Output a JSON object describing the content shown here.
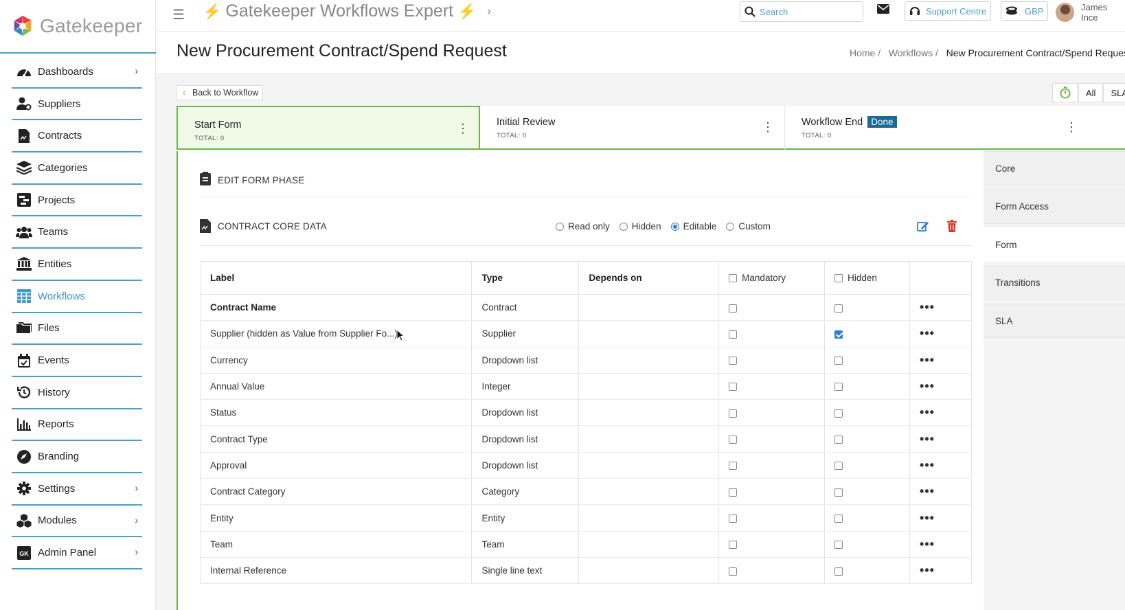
{
  "brand": {
    "name": "Gatekeeper",
    "colors": {
      "accent": "#4a9fc4",
      "green": "#6bb64a",
      "blue": "#2a7de1",
      "red": "#d9362b"
    }
  },
  "sidebar": {
    "items": [
      {
        "label": "Dashboards",
        "icon": "gauge-icon",
        "chevron": true
      },
      {
        "label": "Suppliers",
        "icon": "user-gear-icon",
        "chevron": false
      },
      {
        "label": "Contracts",
        "icon": "file-contract-icon",
        "chevron": false
      },
      {
        "label": "Categories",
        "icon": "layers-icon",
        "chevron": false
      },
      {
        "label": "Projects",
        "icon": "project-icon",
        "chevron": false
      },
      {
        "label": "Teams",
        "icon": "users-icon",
        "chevron": false
      },
      {
        "label": "Entities",
        "icon": "bank-icon",
        "chevron": false
      },
      {
        "label": "Workflows",
        "icon": "grid-table-icon",
        "chevron": false,
        "active": true
      },
      {
        "label": "Files",
        "icon": "folders-icon",
        "chevron": false
      },
      {
        "label": "Events",
        "icon": "calendar-icon",
        "chevron": false
      },
      {
        "label": "History",
        "icon": "history-icon",
        "chevron": false
      },
      {
        "label": "Reports",
        "icon": "bar-chart-icon",
        "chevron": false
      },
      {
        "label": "Branding",
        "icon": "compass-icon",
        "chevron": false
      },
      {
        "label": "Settings",
        "icon": "gear-icon",
        "chevron": true
      },
      {
        "label": "Modules",
        "icon": "cubes-icon",
        "chevron": true
      },
      {
        "label": "Admin Panel",
        "icon": "gk-badge-icon",
        "chevron": true
      }
    ]
  },
  "topbar": {
    "workflow_title": "Gatekeeper Workflows Expert",
    "search_placeholder": "Search",
    "support_label": "Support Centre",
    "currency_label": "GBP",
    "user_name": "James Ince"
  },
  "page": {
    "title": "New Procurement Contract/Spend Request",
    "breadcrumb": {
      "home": "Home",
      "sep": "/",
      "workflows": "Workflows",
      "current": "New Procurement Contract/Spend Request"
    },
    "back_label": "Back to Workflow",
    "filter_all": "All",
    "filter_sla": "SLA"
  },
  "phases": [
    {
      "name": "Start Form",
      "total": "TOTAL: 0",
      "active": true
    },
    {
      "name": "Initial Review",
      "total": "TOTAL: 0"
    },
    {
      "name": "Workflow End",
      "badge": "Done",
      "total": "TOTAL: 0"
    }
  ],
  "editor": {
    "edit_phase_label": "EDIT FORM PHASE",
    "section_label": "CONTRACT CORE DATA",
    "radios": [
      {
        "label": "Read only",
        "checked": false
      },
      {
        "label": "Hidden",
        "checked": false
      },
      {
        "label": "Editable",
        "checked": true
      },
      {
        "label": "Custom",
        "checked": false
      }
    ],
    "table": {
      "headers": {
        "label": "Label",
        "type": "Type",
        "depends": "Depends on",
        "mandatory": "Mandatory",
        "hidden": "Hidden"
      },
      "rows": [
        {
          "label": "Contract Name",
          "type": "Contract",
          "mandatory": false,
          "hidden": false,
          "bold": true
        },
        {
          "label": "Supplier (hidden as Value from Supplier Fo...)",
          "type": "Supplier",
          "mandatory": false,
          "hidden": true
        },
        {
          "label": "Currency",
          "type": "Dropdown list",
          "mandatory": false,
          "hidden": false
        },
        {
          "label": "Annual Value",
          "type": "Integer",
          "mandatory": false,
          "hidden": false
        },
        {
          "label": "Status",
          "type": "Dropdown list",
          "mandatory": false,
          "hidden": false
        },
        {
          "label": "Contract Type",
          "type": "Dropdown list",
          "mandatory": false,
          "hidden": false
        },
        {
          "label": "Approval",
          "type": "Dropdown list",
          "mandatory": false,
          "hidden": false
        },
        {
          "label": "Contract Category",
          "type": "Category",
          "mandatory": false,
          "hidden": false
        },
        {
          "label": "Entity",
          "type": "Entity",
          "mandatory": false,
          "hidden": false
        },
        {
          "label": "Team",
          "type": "Team",
          "mandatory": false,
          "hidden": false
        },
        {
          "label": "Internal Reference",
          "type": "Single line text",
          "mandatory": false,
          "hidden": false
        }
      ]
    }
  },
  "right_tabs": [
    {
      "label": "Core"
    },
    {
      "label": "Form Access"
    },
    {
      "label": "Form",
      "active": true
    },
    {
      "label": "Transitions"
    },
    {
      "label": "SLA"
    }
  ]
}
